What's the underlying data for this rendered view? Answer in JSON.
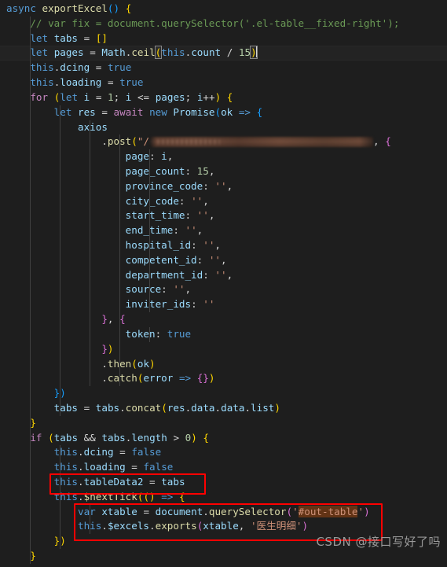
{
  "editor": {
    "language": "javascript",
    "theme": "dark-plus",
    "background_color": "#1e1e1e",
    "foreground_color": "#d4d4d4",
    "active_line_index": 3,
    "colors": {
      "keyword": "#569cd6",
      "control": "#c586c0",
      "function": "#dcdcaa",
      "variable": "#9cdcfe",
      "string": "#ce9178",
      "number": "#b5cea8",
      "comment": "#6a9955",
      "bracket_yellow": "#ffd700",
      "bracket_magenta": "#da70d6",
      "bracket_blue": "#179fff",
      "selection_highlight": "#623315",
      "annotation_red": "#ff0000",
      "active_line": "#232323",
      "indent_guide": "#404040"
    }
  },
  "code": {
    "lines": [
      "async exportExcel() {",
      "    // var fix = document.querySelector('.el-table__fixed-right');",
      "    let tabs = []",
      "    let pages = Math.ceil(this.count / 15)",
      "    this.dcing = true",
      "    this.loading = true",
      "    for (let i = 1; i <= pages; i++) {",
      "        let res = await new Promise(ok => {",
      "            axios",
      "                .post(\"/████████████████████████\", {",
      "                    page: i,",
      "                    page_count: 15,",
      "                    province_code: '',",
      "                    city_code: '',",
      "                    start_time: '',",
      "                    end_time: '',",
      "                    hospital_id: '',",
      "                    competent_id: '',",
      "                    department_id: '',",
      "                    source: '',",
      "                    inviter_ids: ''",
      "                }, {",
      "                    token: true",
      "                })",
      "                .then(ok)",
      "                .catch(error => {})",
      "        })",
      "        tabs = tabs.concat(res.data.data.list)",
      "    }",
      "    if (tabs && tabs.length > 0) {",
      "        this.dcing = false",
      "        this.loading = false",
      "        this.tableData2 = tabs",
      "        this.$nextTick(() => {",
      "            var xtable = document.querySelector('#out-table')",
      "            this.$excels.exports(xtable, '医生明细')",
      "        })",
      "    }"
    ],
    "redacted_url_note": "post URL is blurred/anonymized in the screenshot",
    "highlighted_token": "#out-table",
    "chinese_string": "医生明细"
  },
  "annotations": [
    {
      "name": "annotation-box-table-data",
      "target_line": "this.tableData2 = tabs"
    },
    {
      "name": "annotation-box-export",
      "target_line": "var xtable = document.querySelector('#out-table') / this.$excels.exports(xtable, '医生明细')"
    }
  ],
  "watermark": {
    "text": "CSDN @接口写好了吗"
  }
}
